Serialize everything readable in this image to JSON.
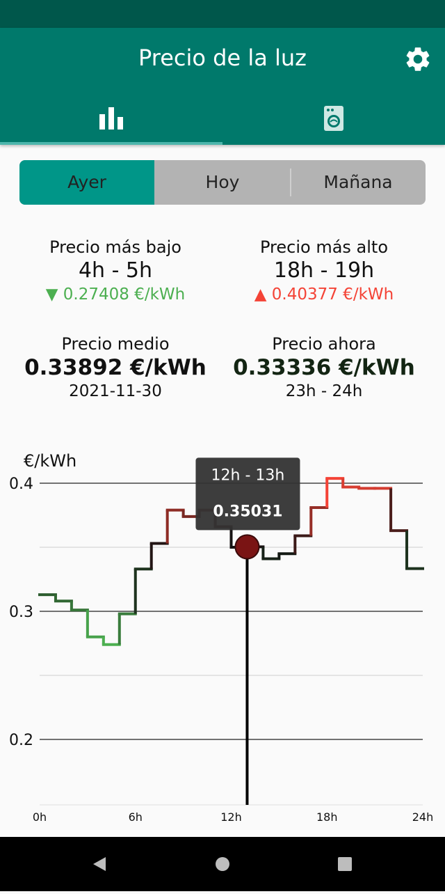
{
  "app": {
    "title": "Precio de la luz"
  },
  "tabs": [
    {
      "icon": "bar-chart-icon"
    },
    {
      "icon": "washing-machine-icon"
    }
  ],
  "segments": {
    "ayer": "Ayer",
    "hoy": "Hoy",
    "manana": "Mañana",
    "selected": "Ayer"
  },
  "stats": {
    "lowest": {
      "label": "Precio más bajo",
      "range": "4h - 5h",
      "value": "▼ 0.27408 €/kWh"
    },
    "highest": {
      "label": "Precio más alto",
      "range": "18h - 19h",
      "value": "▲ 0.40377 €/kWh"
    },
    "average": {
      "label": "Precio medio",
      "value": "0.33892 €/kWh",
      "date": "2021-11-30"
    },
    "now": {
      "label": "Precio ahora",
      "value": "0.33336 €/kWh",
      "range": "23h - 24h"
    }
  },
  "chart_data": {
    "type": "line",
    "ylabel": "€/kWh",
    "xlabel": "",
    "ylim": [
      0.15,
      0.42
    ],
    "xlim": [
      0,
      24
    ],
    "y_ticks": [
      "0.4",
      "0.3",
      "0.2"
    ],
    "x_ticks": [
      "0h",
      "6h",
      "12h",
      "18h",
      "24h"
    ],
    "hours": [
      0,
      1,
      2,
      3,
      4,
      5,
      6,
      7,
      8,
      9,
      10,
      11,
      12,
      13,
      14,
      15,
      16,
      17,
      18,
      19,
      20,
      21,
      22,
      23
    ],
    "values": [
      0.313,
      0.308,
      0.301,
      0.28,
      0.27408,
      0.298,
      0.333,
      0.353,
      0.379,
      0.374,
      0.379,
      0.366,
      0.35,
      0.35031,
      0.341,
      0.345,
      0.359,
      0.381,
      0.40377,
      0.397,
      0.396,
      0.396,
      0.363,
      0.33336
    ],
    "tooltip": {
      "range": "12h - 13h",
      "value": "0.35031"
    },
    "selected_hour": 13,
    "colors": {
      "low": "#4caf50",
      "high": "#f44336",
      "mid": "#111111",
      "marker": "#7a1414"
    }
  },
  "nav": [
    {
      "icon": "back-icon"
    },
    {
      "icon": "home-icon"
    },
    {
      "icon": "recents-icon"
    }
  ]
}
